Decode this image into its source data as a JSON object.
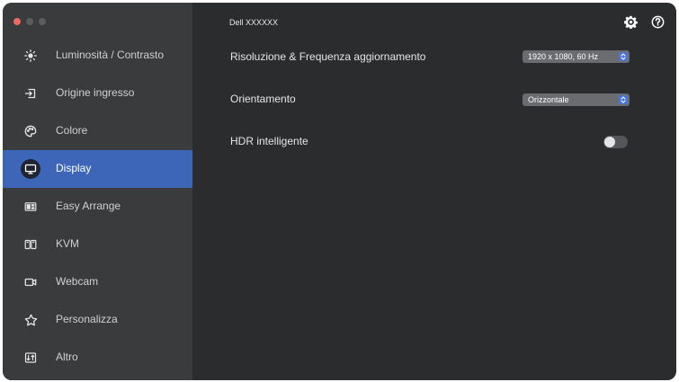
{
  "window": {
    "traffic_lights": {
      "close": "#ec6a5e",
      "minimize": "#5b5c5e",
      "zoom": "#5b5c5e"
    }
  },
  "sidebar": {
    "active_index": 3,
    "accent_color": "#3d66b8",
    "items": [
      {
        "label": "Luminosità / Contrasto",
        "icon": "brightness-icon"
      },
      {
        "label": "Origine ingresso",
        "icon": "input-source-icon"
      },
      {
        "label": "Colore",
        "icon": "color-palette-icon"
      },
      {
        "label": "Display",
        "icon": "monitor-icon"
      },
      {
        "label": "Easy Arrange",
        "icon": "easy-arrange-icon"
      },
      {
        "label": "KVM",
        "icon": "kvm-icon"
      },
      {
        "label": "Webcam",
        "icon": "webcam-icon"
      },
      {
        "label": "Personalizza",
        "icon": "star-icon"
      },
      {
        "label": "Altro",
        "icon": "other-icon"
      }
    ]
  },
  "header": {
    "monitor_name": "Dell XXXXXX",
    "settings_icon": "gear-icon",
    "help_icon": "help-icon"
  },
  "settings": {
    "resolution": {
      "label": "Risoluzione & Frequenza aggiornamento",
      "value": "1920 x 1080, 60 Hz"
    },
    "orientation": {
      "label": "Orientamento",
      "value": "Orizzontale"
    },
    "hdr": {
      "label": "HDR intelligente",
      "enabled": false
    }
  }
}
